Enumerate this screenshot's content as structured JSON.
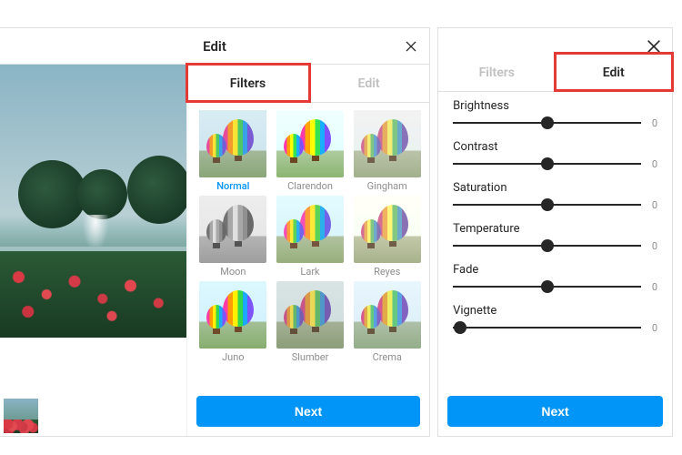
{
  "left": {
    "title": "Edit",
    "tabs": {
      "filters": "Filters",
      "edit": "Edit",
      "active": "filters"
    },
    "filters": [
      {
        "name": "Normal",
        "key": "no",
        "selected": true
      },
      {
        "name": "Clarendon",
        "key": "cl"
      },
      {
        "name": "Gingham",
        "key": "gi"
      },
      {
        "name": "Moon",
        "key": "mo"
      },
      {
        "name": "Lark",
        "key": "la"
      },
      {
        "name": "Reyes",
        "key": "re"
      },
      {
        "name": "Juno",
        "key": "ju"
      },
      {
        "name": "Slumber",
        "key": "sl"
      },
      {
        "name": "Crema",
        "key": "cr"
      }
    ],
    "next": "Next"
  },
  "right": {
    "tabs": {
      "filters": "Filters",
      "edit": "Edit",
      "active": "edit"
    },
    "adjustments": [
      {
        "label": "Brightness",
        "value": 0,
        "pos": 50
      },
      {
        "label": "Contrast",
        "value": 0,
        "pos": 50
      },
      {
        "label": "Saturation",
        "value": 0,
        "pos": 50
      },
      {
        "label": "Temperature",
        "value": 0,
        "pos": 50
      },
      {
        "label": "Fade",
        "value": 0,
        "pos": 50
      },
      {
        "label": "Vignette",
        "value": 0,
        "pos": 4
      }
    ],
    "next": "Next"
  }
}
